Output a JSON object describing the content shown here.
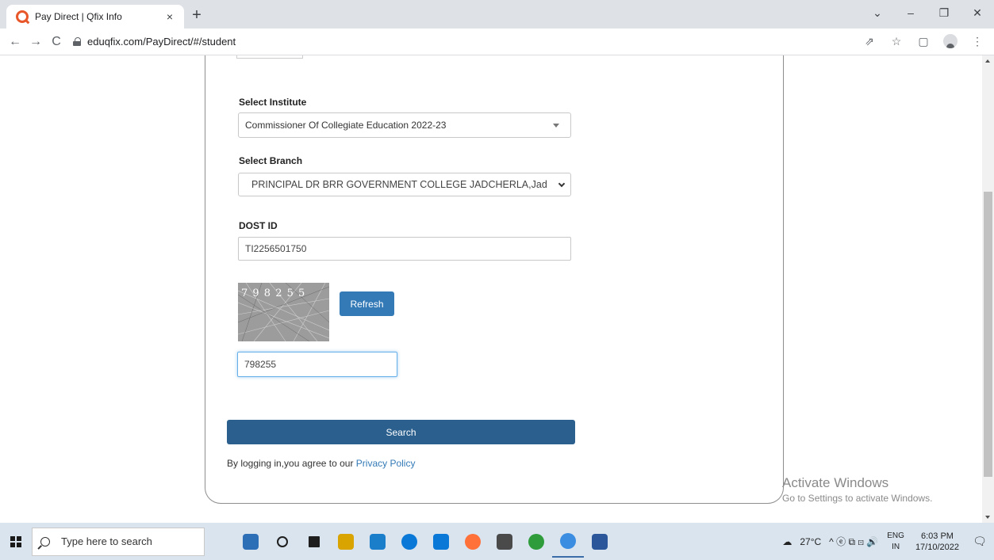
{
  "browser": {
    "tab_title": "Pay Direct | Qfix Info",
    "tab_close": "×",
    "new_tab": "+",
    "url": "eduqfix.com/PayDirect/#/student",
    "window_controls": {
      "dropdown": "⌄",
      "minimize": "–",
      "restore": "❐",
      "close": "✕"
    },
    "nav": {
      "back": "←",
      "forward": "→",
      "reload": "C"
    },
    "toolbar_icons": {
      "share": "⇗",
      "bookmark": "☆",
      "side_panel": "▢",
      "menu": "⋮"
    }
  },
  "form": {
    "institute_label": "Select Institute",
    "institute_value": "Commissioner Of Collegiate Education 2022-23",
    "branch_label": "Select Branch",
    "branch_value": "PRINCIPAL DR BRR GOVERNMENT COLLEGE JADCHERLA,Jad",
    "dost_label": "DOST ID",
    "dost_value": "TI2256501750",
    "captcha_digits": "7 9  8 2 5  5",
    "refresh_label": "Refresh",
    "captcha_value": "798255",
    "search_label": "Search",
    "privacy_prefix": "By logging in,you agree to our ",
    "privacy_link": "Privacy Policy"
  },
  "watermark": {
    "line1": "Activate Windows",
    "line2": "Go to Settings to activate Windows."
  },
  "taskbar": {
    "search_placeholder": "Type here to search",
    "weather": "27°C",
    "tray_icons": "^ ⓔ ⧉ ⊡ 🔊",
    "language_top": "ENG",
    "language_bottom": "IN",
    "time": "6:03 PM",
    "date": "17/10/2022",
    "notification_icon": "🗨",
    "app_colors": [
      "#2d6fb7",
      "#1e1e1e",
      "#d9a400",
      "#1b7ecb",
      "#0a78d7",
      "#ff7139",
      "#4a4a4a",
      "#2e9c3a",
      "#3a8de0",
      "#2b579a"
    ]
  }
}
